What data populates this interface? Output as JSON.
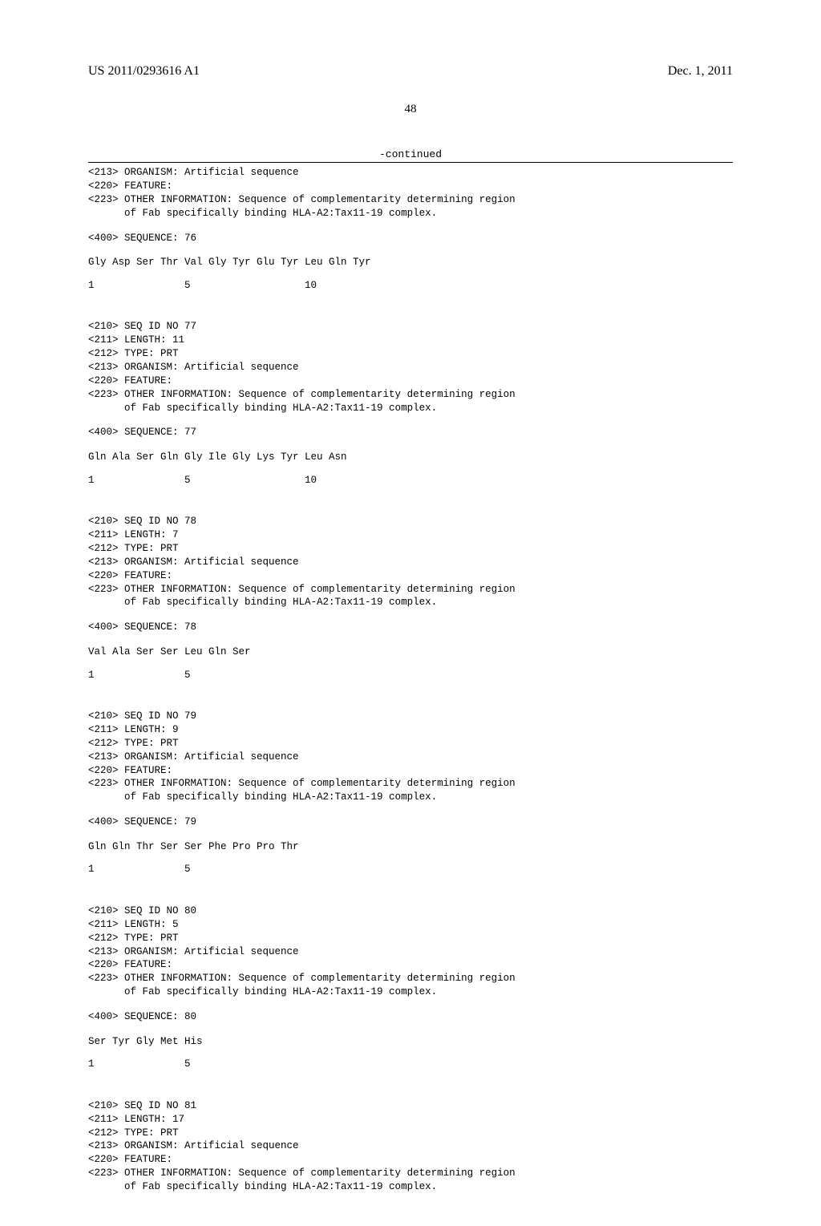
{
  "header": {
    "pub_number": "US 2011/0293616 A1",
    "pub_date": "Dec. 1, 2011"
  },
  "page_number": "48",
  "continued_label": "-continued",
  "common": {
    "tag213": "<213> ORGANISM: Artificial sequence",
    "tag220": "<220> FEATURE:",
    "tag223_l1": "<223> OTHER INFORMATION: Sequence of complementarity determining region",
    "tag223_l2": "      of Fab specifically binding HLA-A2:Tax11-19 complex.",
    "tag212": "<212> TYPE: PRT"
  },
  "seqs": {
    "s76": {
      "seq400": "<400> SEQUENCE: 76",
      "residues": "Gly Asp Ser Thr Val Gly Tyr Glu Tyr Leu Gln Tyr",
      "positions": "1               5                   10"
    },
    "s77": {
      "tag210": "<210> SEQ ID NO 77",
      "tag211": "<211> LENGTH: 11",
      "seq400": "<400> SEQUENCE: 77",
      "residues": "Gln Ala Ser Gln Gly Ile Gly Lys Tyr Leu Asn",
      "positions": "1               5                   10"
    },
    "s78": {
      "tag210": "<210> SEQ ID NO 78",
      "tag211": "<211> LENGTH: 7",
      "seq400": "<400> SEQUENCE: 78",
      "residues": "Val Ala Ser Ser Leu Gln Ser",
      "positions": "1               5"
    },
    "s79": {
      "tag210": "<210> SEQ ID NO 79",
      "tag211": "<211> LENGTH: 9",
      "seq400": "<400> SEQUENCE: 79",
      "residues": "Gln Gln Thr Ser Ser Phe Pro Pro Thr",
      "positions": "1               5"
    },
    "s80": {
      "tag210": "<210> SEQ ID NO 80",
      "tag211": "<211> LENGTH: 5",
      "seq400": "<400> SEQUENCE: 80",
      "residues": "Ser Tyr Gly Met His",
      "positions": "1               5"
    },
    "s81": {
      "tag210": "<210> SEQ ID NO 81",
      "tag211": "<211> LENGTH: 17"
    }
  }
}
